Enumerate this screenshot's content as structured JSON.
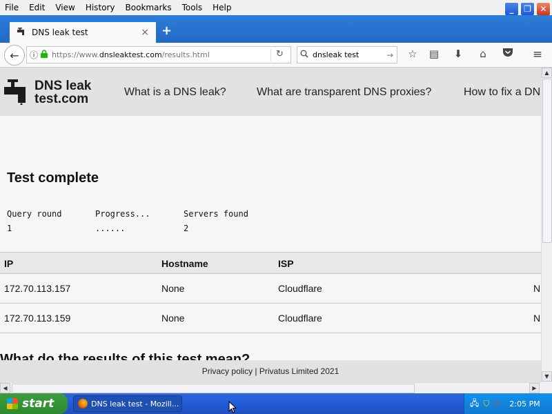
{
  "menubar": {
    "items": [
      "File",
      "Edit",
      "View",
      "History",
      "Bookmarks",
      "Tools",
      "Help"
    ]
  },
  "tab": {
    "title": "DNS leak test",
    "close": "×",
    "new_tab": "+"
  },
  "navbar": {
    "url_prefix": "https://www.",
    "url_domain": "dnsleaktest.com",
    "url_path": "/results.html",
    "search_value": "dnsleak test"
  },
  "site": {
    "logo_line1": "DNS leak",
    "logo_line2": "test.com",
    "nav": [
      "What is a DNS leak?",
      "What are transparent DNS proxies?",
      "How to fix a DN"
    ]
  },
  "test": {
    "title": "Test complete",
    "headers": [
      "Query round",
      "Progress...",
      "Servers found"
    ],
    "values": [
      "1",
      "......",
      "2"
    ]
  },
  "results": {
    "columns": [
      "IP",
      "Hostname",
      "ISP"
    ],
    "rows": [
      {
        "ip": "172.70.113.157",
        "hostname": "None",
        "isp": "Cloudflare",
        "country_cut": "N"
      },
      {
        "ip": "172.70.113.159",
        "hostname": "None",
        "isp": "Cloudflare",
        "country_cut": "N"
      }
    ]
  },
  "next_heading": "What do the results of this test mean?",
  "footer": "Privacy policy | Privatus Limited 2021",
  "taskbar": {
    "start": "start",
    "window": "DNS leak test - Mozill...",
    "clock": "2:05 PM"
  }
}
